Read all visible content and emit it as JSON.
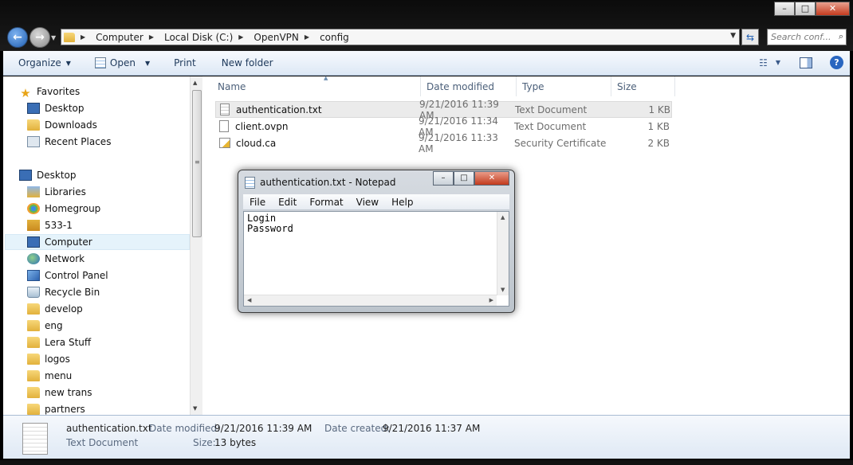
{
  "window": {
    "min_label": "–",
    "max_label": "□",
    "close_label": "✕"
  },
  "address": {
    "crumbs": [
      "Computer",
      "Local Disk (C:)",
      "OpenVPN",
      "config"
    ],
    "search_placeholder": "Search conf..."
  },
  "toolbar": {
    "organize": "Organize",
    "open": "Open",
    "print": "Print",
    "new_folder": "New folder"
  },
  "nav": {
    "favorites": "Favorites",
    "fav_items": [
      "Desktop",
      "Downloads",
      "Recent Places"
    ],
    "desktop": "Desktop",
    "items": [
      "Libraries",
      "Homegroup",
      "533-1",
      "Computer",
      "Network",
      "Control Panel",
      "Recycle Bin",
      "develop",
      "eng",
      "Lera Stuff",
      "logos",
      "menu",
      "new trans",
      "partners"
    ],
    "selected": "Computer"
  },
  "columns": [
    "Name",
    "Date modified",
    "Type",
    "Size"
  ],
  "files": [
    {
      "name": "authentication.txt",
      "date": "9/21/2016 11:39 AM",
      "type": "Text Document",
      "size": "1 KB",
      "icon": "text-file-icon"
    },
    {
      "name": "client.ovpn",
      "date": "9/21/2016 11:34 AM",
      "type": "Text Document",
      "size": "1 KB",
      "icon": "text-file-icon"
    },
    {
      "name": "cloud.ca",
      "date": "9/21/2016 11:33 AM",
      "type": "Security Certificate",
      "size": "2 KB",
      "icon": "certificate-icon"
    }
  ],
  "notepad": {
    "title": "authentication.txt - Notepad",
    "menu": [
      "File",
      "Edit",
      "Format",
      "View",
      "Help"
    ],
    "lines": [
      "Login",
      "Password"
    ]
  },
  "details": {
    "filename": "authentication.txt",
    "filetype": "Text Document",
    "date_modified_label": "Date modified:",
    "date_modified": "9/21/2016 11:39 AM",
    "size_label": "Size:",
    "size": "13 bytes",
    "date_created_label": "Date created:",
    "date_created": "9/21/2016 11:37 AM"
  }
}
